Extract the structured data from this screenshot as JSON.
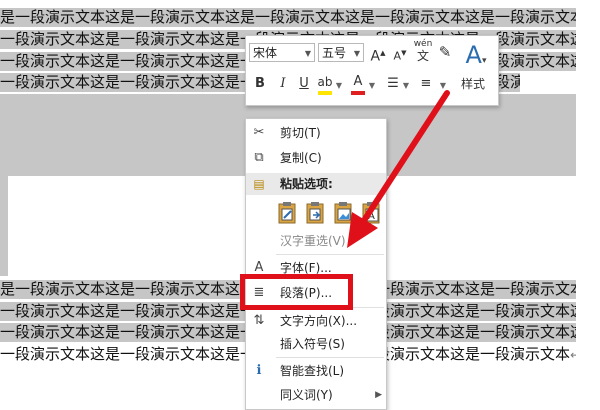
{
  "document": {
    "lines": [
      {
        "text": "是一段演示文本这是一段演示文本这是一段演示文本这是一段演示文本这是一段演示文本这",
        "selected": true
      },
      {
        "text": "一段演示文本这是一段演示文本这是一段演示文本这是一段演示文本这是一段演示文本这是",
        "selected": true
      },
      {
        "text": "一段演示文本这是一段演示文本这是一段演示文本这是一段演示文本这是一段演示文本这是",
        "selected": true
      },
      {
        "text": "一段演示文本这是一段演示文本这是一段演示文本这是一段演示文本这是一段演示文本",
        "selected": true,
        "pilcrow": "↵"
      },
      {
        "text": "是一段演示文本这是一段演示文本这是一段演示文本这是一段演示文本这是一段演示文本这",
        "selected": true
      },
      {
        "text": "一段演示文本这是一段演示文本这是一段演示文本这是一段演示文本这是一段演示文本这是",
        "selected": true
      },
      {
        "text": "一段演示文本这是一段演示文本这是一段演示文本这是一段演示文本这是一段演示文本这是",
        "selected": true
      },
      {
        "text": "一段演示文本这是一段演示文本这是一段演示文本这是一段演示文本这是一段演示文本这是",
        "selected": true
      },
      {
        "text": "一段演示文本这是一段演示文本这是一段演示文本这是一段演示文本这是一段演示文本",
        "selected": false,
        "pilcrow": "↵"
      }
    ]
  },
  "mini_toolbar": {
    "font_name": "宋体",
    "font_size": "五号",
    "grow_font": "A",
    "shrink_font": "A",
    "phonetic": "wén",
    "bold": "B",
    "italic": "I",
    "underline": "U",
    "highlight_color": "#ffe600",
    "font_color": "#e02020",
    "style_label": "样式"
  },
  "context_menu": {
    "items": [
      {
        "icon": "cut-icon",
        "glyph": "✂",
        "label": "剪切(T)"
      },
      {
        "icon": "copy-icon",
        "glyph": "⧉",
        "label": "复制(C)"
      },
      {
        "icon": "paste-icon",
        "glyph": "📋",
        "label": "粘贴选项:"
      },
      {
        "label": "汉字重选(V)"
      },
      {
        "icon": "font-icon",
        "glyph": "A",
        "label": "字体(F)..."
      },
      {
        "icon": "paragraph-icon",
        "glyph": "≣",
        "label": "段落(P)..."
      },
      {
        "icon": "text-direction-icon",
        "glyph": "⇅",
        "label": "文字方向(X)..."
      },
      {
        "label": "插入符号(S)"
      },
      {
        "icon": "smart-lookup-icon",
        "glyph": "ℹ",
        "label": "智能查找(L)"
      },
      {
        "label": "同义词(Y)",
        "submenu": "▶"
      }
    ]
  },
  "annotation": {
    "highlight_color": "#e0101a",
    "arrow_color": "#e0101a"
  }
}
